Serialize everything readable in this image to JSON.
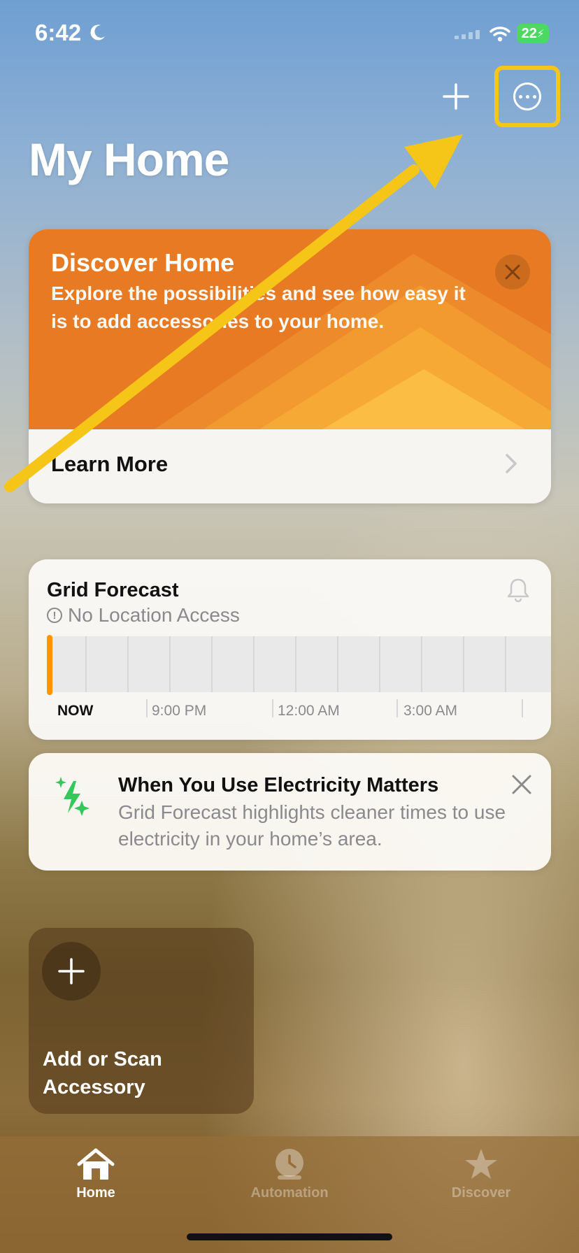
{
  "status_bar": {
    "time": "6:42",
    "battery": "22"
  },
  "header": {
    "title": "My Home"
  },
  "discover_card": {
    "title": "Discover Home",
    "body": "Explore the possibilities and see how easy it is to add accessories to your home.",
    "link": "Learn More"
  },
  "grid_forecast": {
    "title": "Grid Forecast",
    "subtitle": "No Location Access",
    "time_labels": [
      "NOW",
      "9:00 PM",
      "12:00 AM",
      "3:00 AM"
    ]
  },
  "electricity_tip": {
    "title": "When You Use Electricity Matters",
    "body": "Grid Forecast highlights cleaner times to use electricity in your home’s area."
  },
  "add_tile": {
    "label": "Add or Scan Accessory"
  },
  "tabs": [
    {
      "label": "Home",
      "icon": "house-icon",
      "active": true
    },
    {
      "label": "Automation",
      "icon": "clock-icon",
      "active": false
    },
    {
      "label": "Discover",
      "icon": "star-icon",
      "active": false
    }
  ],
  "colors": {
    "highlight": "#f5c518",
    "discover_orange": "#e77a22",
    "now_marker": "#ff9500",
    "electricity_green": "#34c759"
  }
}
